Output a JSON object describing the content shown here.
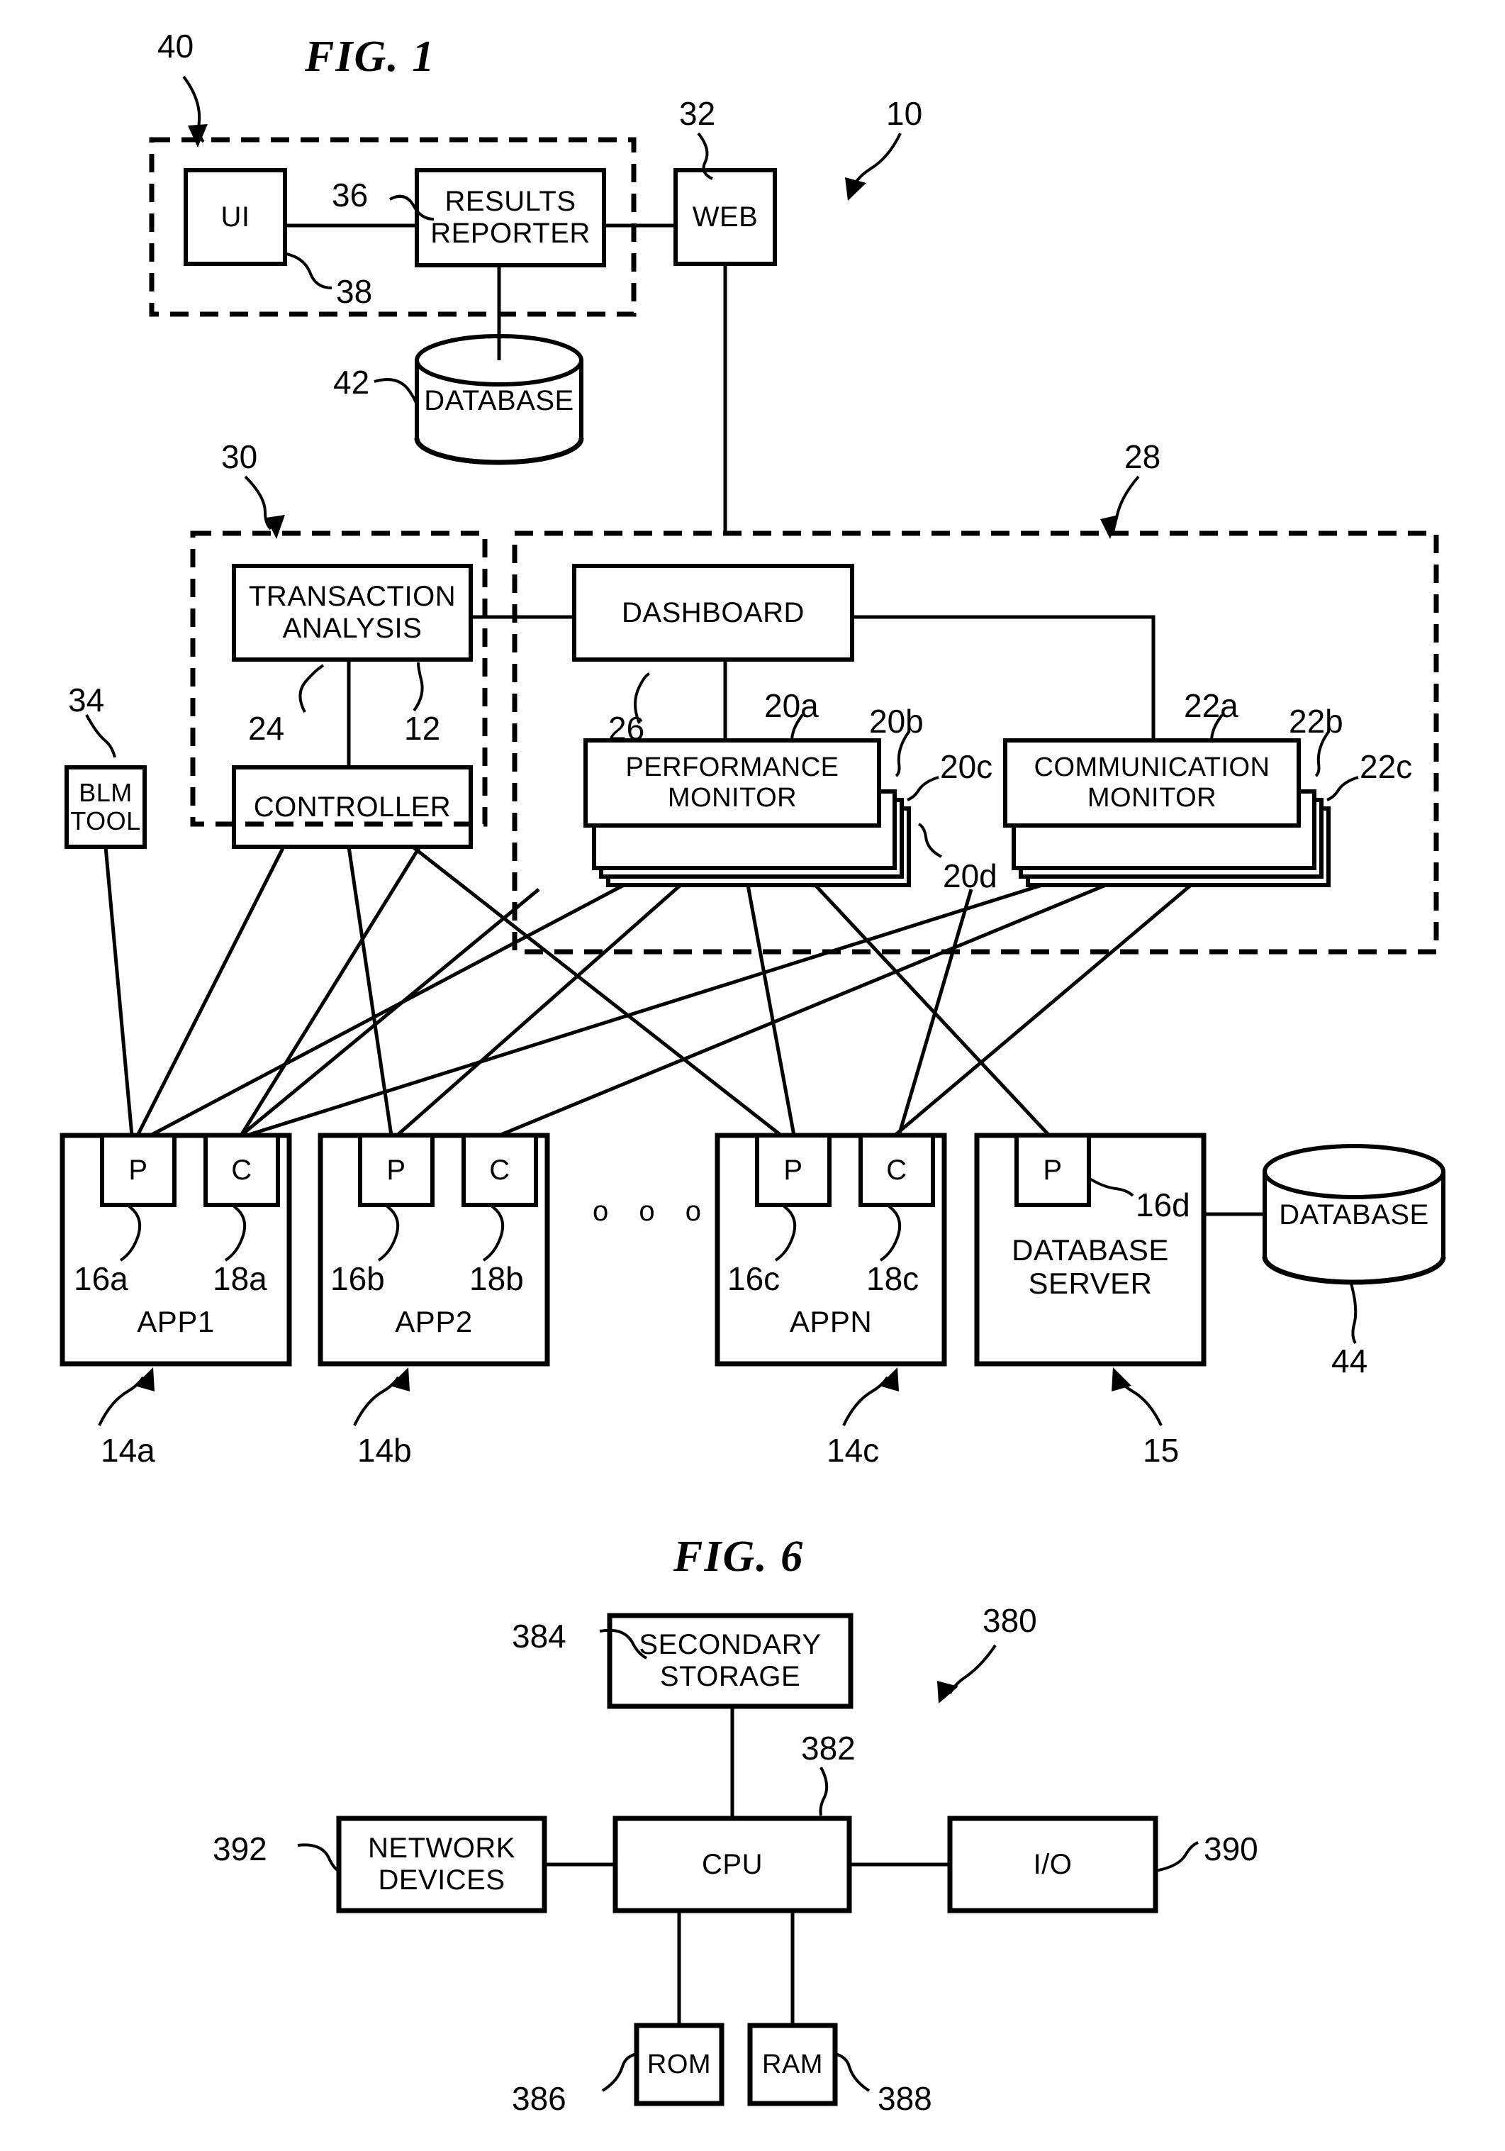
{
  "figures": [
    {
      "id": "fig1",
      "title": "FIG. 1"
    },
    {
      "id": "fig6",
      "title": "FIG. 6"
    }
  ],
  "fig1": {
    "title": "FIG. 1",
    "boxes": {
      "ui": "UI",
      "results_reporter": "RESULTS\nREPORTER",
      "web": "WEB",
      "database_top": "DATABASE",
      "transaction_analysis": "TRANSACTION\nANALYSIS",
      "dashboard": "DASHBOARD",
      "blm_tool": "BLM\nTOOL",
      "controller": "CONTROLLER",
      "performance_monitor": "PERFORMANCE\nMONITOR",
      "communication_monitor": "COMMUNICATION\nMONITOR",
      "app1": "APP1",
      "app2": "APP2",
      "appn": "APPN",
      "database_server": "DATABASE\nSERVER",
      "database_right": "DATABASE",
      "probe": "P",
      "collector": "C",
      "ellipsis": "o o o"
    },
    "refs": {
      "system_40": "40",
      "results_reporter_36": "36",
      "ui_38": "38",
      "web_32": "32",
      "system_10": "10",
      "database_42": "42",
      "group_30": "30",
      "group_28": "28",
      "blm_34": "34",
      "transaction_24": "24",
      "controller_12": "12",
      "dashboard_26": "26",
      "perf_20a": "20a",
      "perf_20b": "20b",
      "perf_20c": "20c",
      "perf_20d": "20d",
      "comm_22a": "22a",
      "comm_22b": "22b",
      "comm_22c": "22c",
      "probe_16a": "16a",
      "collector_18a": "18a",
      "probe_16b": "16b",
      "collector_18b": "18b",
      "probe_16c": "16c",
      "collector_18c": "18c",
      "probe_16d": "16d",
      "app_14a": "14a",
      "app_14b": "14b",
      "app_14c": "14c",
      "dbserver_15": "15",
      "database_44": "44"
    }
  },
  "fig6": {
    "title": "FIG. 6",
    "boxes": {
      "secondary_storage": "SECONDARY\nSTORAGE",
      "cpu": "CPU",
      "network_devices": "NETWORK\nDEVICES",
      "io": "I/O",
      "rom": "ROM",
      "ram": "RAM"
    },
    "refs": {
      "secondary_storage_384": "384",
      "system_380": "380",
      "cpu_382": "382",
      "network_devices_392": "392",
      "io_390": "390",
      "rom_386": "386",
      "ram_388": "388"
    }
  },
  "colors": {
    "ink": "#000000",
    "paper": "#ffffff"
  }
}
